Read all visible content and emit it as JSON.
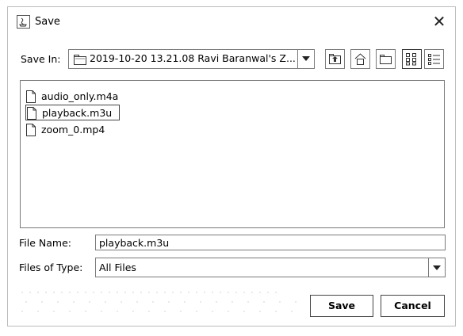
{
  "window": {
    "title": "Save",
    "close_glyph": "✕"
  },
  "toolbar": {
    "save_in_label": "Save In:",
    "current_folder": "2019-10-20 13.21.08 Ravi Baranwal's Z...",
    "buttons": [
      "up-one-level",
      "home",
      "new-folder",
      "list-view",
      "details-view"
    ]
  },
  "files": [
    {
      "name": "audio_only.m4a",
      "selected": false
    },
    {
      "name": "playback.m3u",
      "selected": true
    },
    {
      "name": "zoom_0.mp4",
      "selected": false
    }
  ],
  "file_name": {
    "label": "File Name:",
    "value": "playback.m3u"
  },
  "file_type": {
    "label": "Files of Type:",
    "value": "All Files"
  },
  "actions": {
    "save_label": "Save",
    "cancel_label": "Cancel"
  }
}
